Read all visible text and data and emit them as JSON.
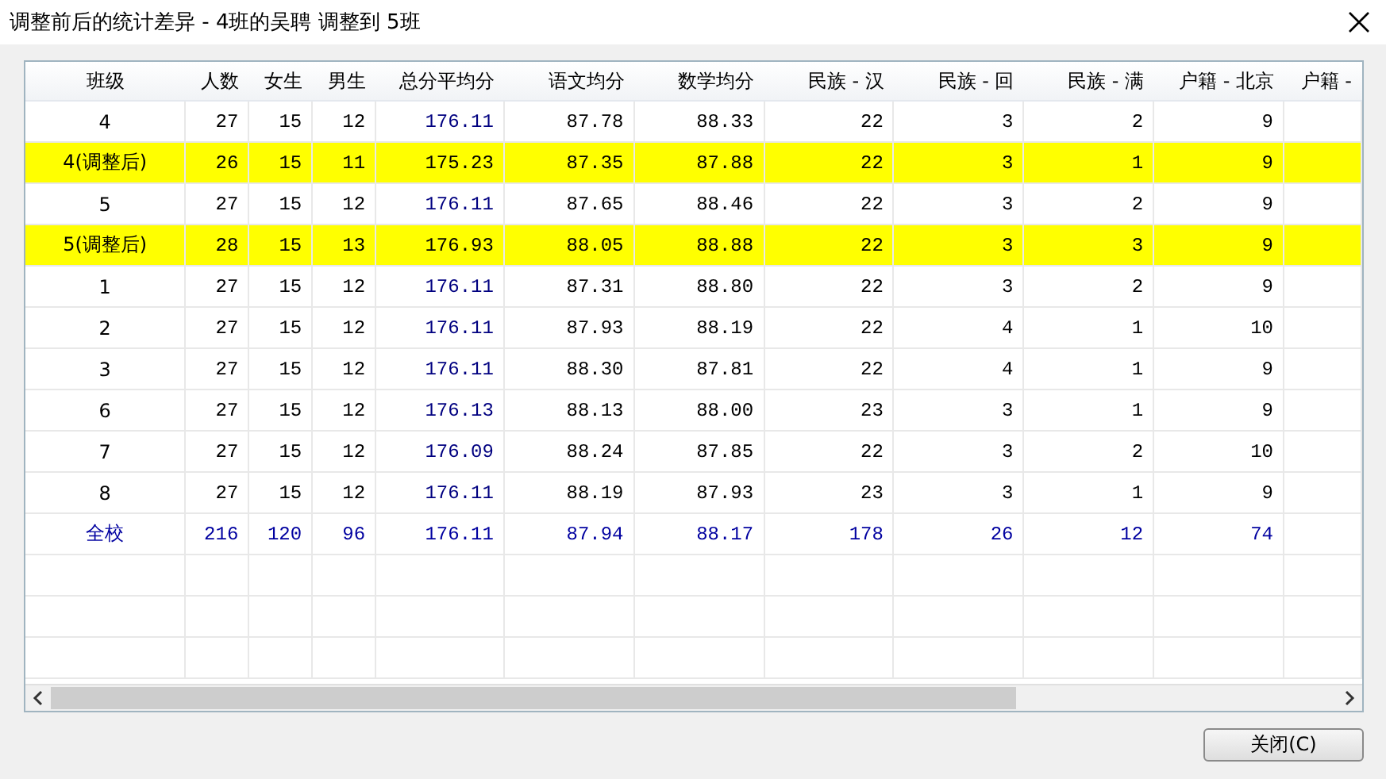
{
  "window": {
    "title": "调整前后的统计差异 - 4班的吴聘 调整到 5班"
  },
  "table": {
    "columns": [
      "班级",
      "人数",
      "女生",
      "男生",
      "总分平均分",
      "语文均分",
      "数学均分",
      "民族 - 汉",
      "民族 - 回",
      "民族 - 满",
      "户籍 - 北京",
      "户籍 -"
    ],
    "rows": [
      {
        "kind": "normal",
        "highlighted": false,
        "cells": [
          "4",
          "27",
          "15",
          "12",
          "176.11",
          "87.78",
          "88.33",
          "22",
          "3",
          "2",
          "9"
        ]
      },
      {
        "kind": "normal",
        "highlighted": true,
        "cells": [
          "4(调整后)",
          "26",
          "15",
          "11",
          "175.23",
          "87.35",
          "87.88",
          "22",
          "3",
          "1",
          "9"
        ]
      },
      {
        "kind": "normal",
        "highlighted": false,
        "cells": [
          "5",
          "27",
          "15",
          "12",
          "176.11",
          "87.65",
          "88.46",
          "22",
          "3",
          "2",
          "9"
        ]
      },
      {
        "kind": "normal",
        "highlighted": true,
        "cells": [
          "5(调整后)",
          "28",
          "15",
          "13",
          "176.93",
          "88.05",
          "88.88",
          "22",
          "3",
          "3",
          "9"
        ]
      },
      {
        "kind": "normal",
        "highlighted": false,
        "cells": [
          "1",
          "27",
          "15",
          "12",
          "176.11",
          "87.31",
          "88.80",
          "22",
          "3",
          "2",
          "9"
        ]
      },
      {
        "kind": "normal",
        "highlighted": false,
        "cells": [
          "2",
          "27",
          "15",
          "12",
          "176.11",
          "87.93",
          "88.19",
          "22",
          "4",
          "1",
          "10"
        ]
      },
      {
        "kind": "normal",
        "highlighted": false,
        "cells": [
          "3",
          "27",
          "15",
          "12",
          "176.11",
          "88.30",
          "87.81",
          "22",
          "4",
          "1",
          "9"
        ]
      },
      {
        "kind": "normal",
        "highlighted": false,
        "cells": [
          "6",
          "27",
          "15",
          "12",
          "176.13",
          "88.13",
          "88.00",
          "23",
          "3",
          "1",
          "9"
        ]
      },
      {
        "kind": "normal",
        "highlighted": false,
        "cells": [
          "7",
          "27",
          "15",
          "12",
          "176.09",
          "88.24",
          "87.85",
          "22",
          "3",
          "2",
          "10"
        ]
      },
      {
        "kind": "normal",
        "highlighted": false,
        "cells": [
          "8",
          "27",
          "15",
          "12",
          "176.11",
          "88.19",
          "87.93",
          "23",
          "3",
          "1",
          "9"
        ]
      },
      {
        "kind": "total",
        "highlighted": false,
        "cells": [
          "全校",
          "216",
          "120",
          "96",
          "176.11",
          "87.94",
          "88.17",
          "178",
          "26",
          "12",
          "74"
        ]
      }
    ]
  },
  "buttons": [
    "关闭(C)"
  ]
}
